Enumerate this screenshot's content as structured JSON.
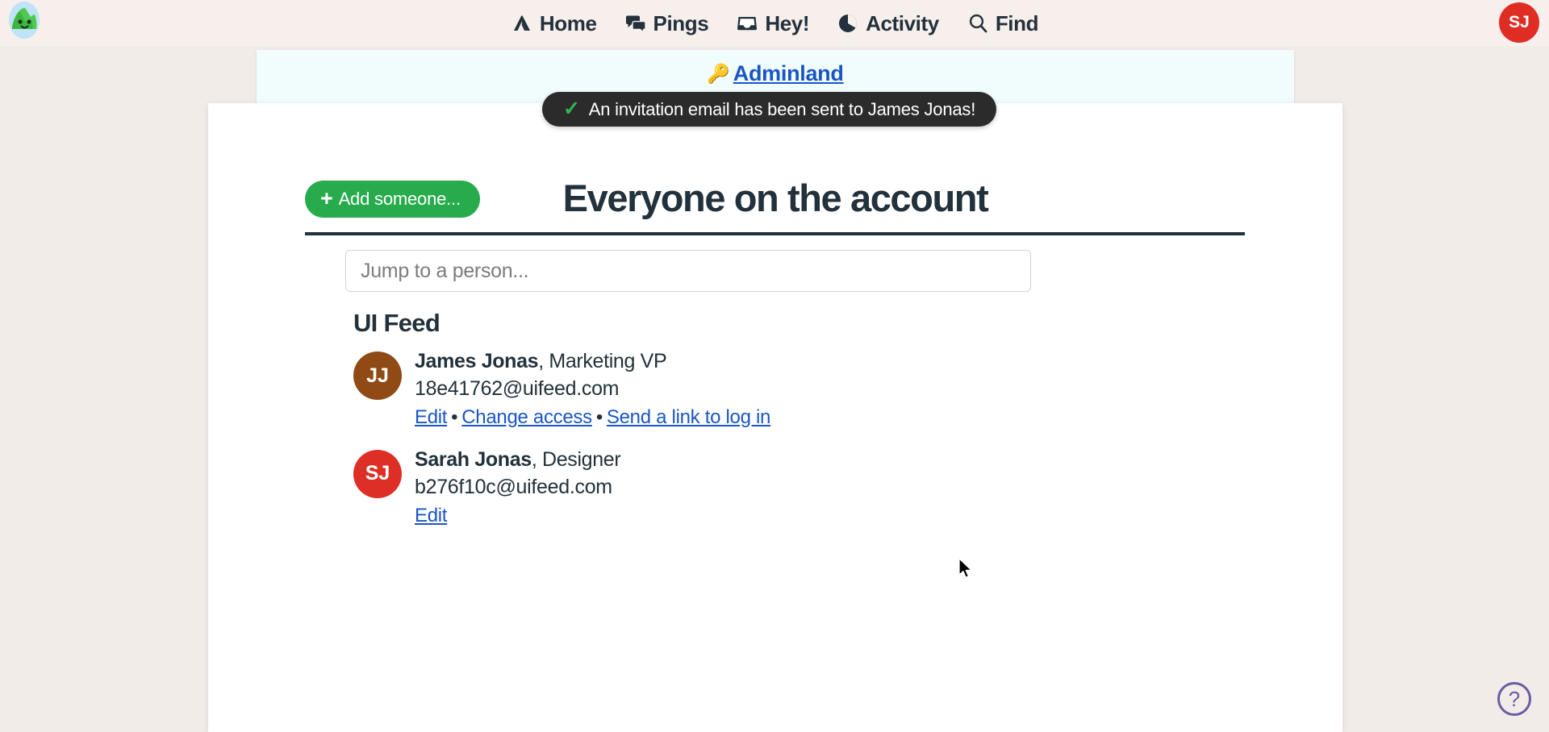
{
  "nav": {
    "logo_icon": "mountain-mascot-logo",
    "items": [
      {
        "label": "Home",
        "icon": "home-icon"
      },
      {
        "label": "Pings",
        "icon": "speech-bubbles-icon"
      },
      {
        "label": "Hey!",
        "icon": "inbox-tray-icon"
      },
      {
        "label": "Activity",
        "icon": "pie-chart-icon"
      },
      {
        "label": "Find",
        "icon": "magnifier-icon"
      }
    ],
    "avatar_initials": "SJ",
    "avatar_color": "#e02d24"
  },
  "banner": {
    "key_icon": "🔑",
    "link_label": "Adminland"
  },
  "toast": {
    "check_icon": "✓",
    "message": "An invitation email has been sent to James Jonas!",
    "check_color": "#2eb84f",
    "background": "#2b2b2b"
  },
  "header": {
    "add_button_label": "Add someone...",
    "add_button_plus": "+",
    "add_button_color": "#27ab4c",
    "title": "Everyone on the account"
  },
  "search": {
    "placeholder": "Jump to a person...",
    "value": ""
  },
  "group": {
    "title": "UI Feed",
    "people": [
      {
        "initials": "JJ",
        "avatar_color": "#8f4a16",
        "name": "James Jonas",
        "role_separator": ", ",
        "role": "Marketing VP",
        "email": "18e41762@uifeed.com",
        "actions": [
          "Edit",
          "Change access",
          "Send a link to log in"
        ],
        "action_separator": "•"
      },
      {
        "initials": "SJ",
        "avatar_color": "#dd2f26",
        "name": "Sarah Jonas",
        "role_separator": ", ",
        "role": "Designer",
        "email": "b276f10c@uifeed.com",
        "actions": [
          "Edit"
        ],
        "action_separator": "•"
      }
    ]
  },
  "help": {
    "label": "?",
    "color": "#6b5ca5"
  },
  "theme": {
    "page_background": "#f2ece9",
    "topbar_background": "#f7efec",
    "card_background": "#ffffff",
    "banner_background": "#f1fdfd",
    "link_color": "#1a56c4",
    "text_color": "#22313b"
  }
}
